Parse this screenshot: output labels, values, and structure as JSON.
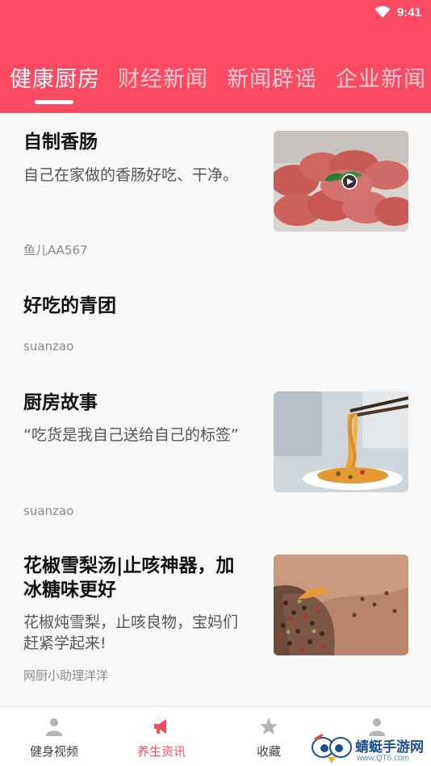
{
  "status_bar": {
    "time": "9:41"
  },
  "tabs": [
    {
      "label": "健康厨房"
    },
    {
      "label": "财经新闻"
    },
    {
      "label": "新闻辟谣"
    },
    {
      "label": "企业新闻"
    }
  ],
  "feed": [
    {
      "title": "自制香肠",
      "desc": "自己在家做的香肠好吃、干净。",
      "author": "鱼儿AA567",
      "has_video": true
    },
    {
      "title": "好吃的青团",
      "author": "suanzao"
    },
    {
      "title": "厨房故事",
      "desc": "“吃货是我自己送给自己的标签”",
      "author": "suanzao"
    },
    {
      "title_line1": "花椒雪梨汤|止咳神器，加",
      "title_line2": "冰糖味更好",
      "desc_line1": "花椒炖雪梨，止咳良物，宝妈们",
      "desc_line2": "赶紧学起来!",
      "author": "网厨小助理洋洋"
    }
  ],
  "bottom_nav": [
    {
      "label": "健身视频",
      "icon": "person-icon"
    },
    {
      "label": "养生资讯",
      "icon": "megaphone-icon"
    },
    {
      "label": "收藏",
      "icon": "star-icon"
    },
    {
      "label": "",
      "icon": "person-icon"
    }
  ],
  "watermark": {
    "text": "蜻蜓手游网",
    "url": "www.QT6.com"
  },
  "colors": {
    "accent": "#fc4a63"
  }
}
